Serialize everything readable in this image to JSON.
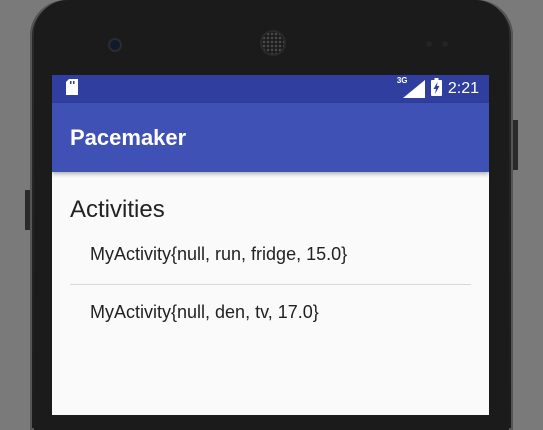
{
  "status_bar": {
    "time": "2:21",
    "network_label": "3G",
    "sd_card_icon": "sd-card-icon",
    "signal_icon": "signal-icon",
    "battery_icon": "battery-charging-icon"
  },
  "app_bar": {
    "title": "Pacemaker"
  },
  "main": {
    "heading": "Activities",
    "activities": [
      "MyActivity{null, run, fridge, 15.0}",
      "MyActivity{null, den, tv, 17.0}"
    ]
  },
  "colors": {
    "status_bar": "#303f9f",
    "app_bar": "#3f51b5",
    "background": "#fafafa"
  }
}
